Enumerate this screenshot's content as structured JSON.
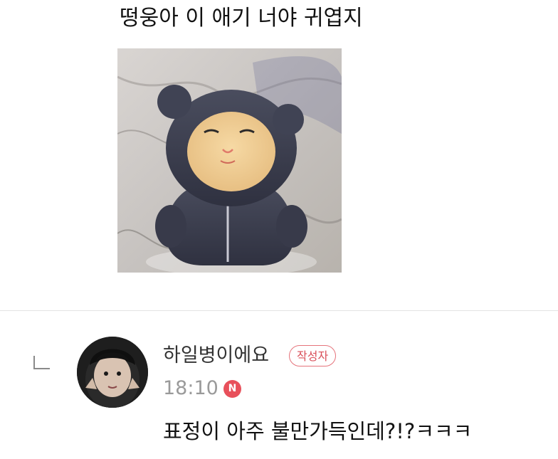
{
  "post": {
    "text": "떵웅아 이 애기 너야 귀엽지",
    "image": {
      "subject": "doll-photo"
    }
  },
  "comment": {
    "reply_icon": "reply-arrow-icon",
    "author": "하일병이에요",
    "author_badge": "작성자",
    "time": "18:10",
    "new_badge": "N",
    "text": "표정이 아주 불만가득인데?!?ㅋㅋㅋ"
  },
  "colors": {
    "badge_border": "#e5737b",
    "badge_text": "#d94f59",
    "new_badge_bg": "#e8505b",
    "time_text": "#9a9a9a",
    "divider": "#e4e4e4"
  }
}
